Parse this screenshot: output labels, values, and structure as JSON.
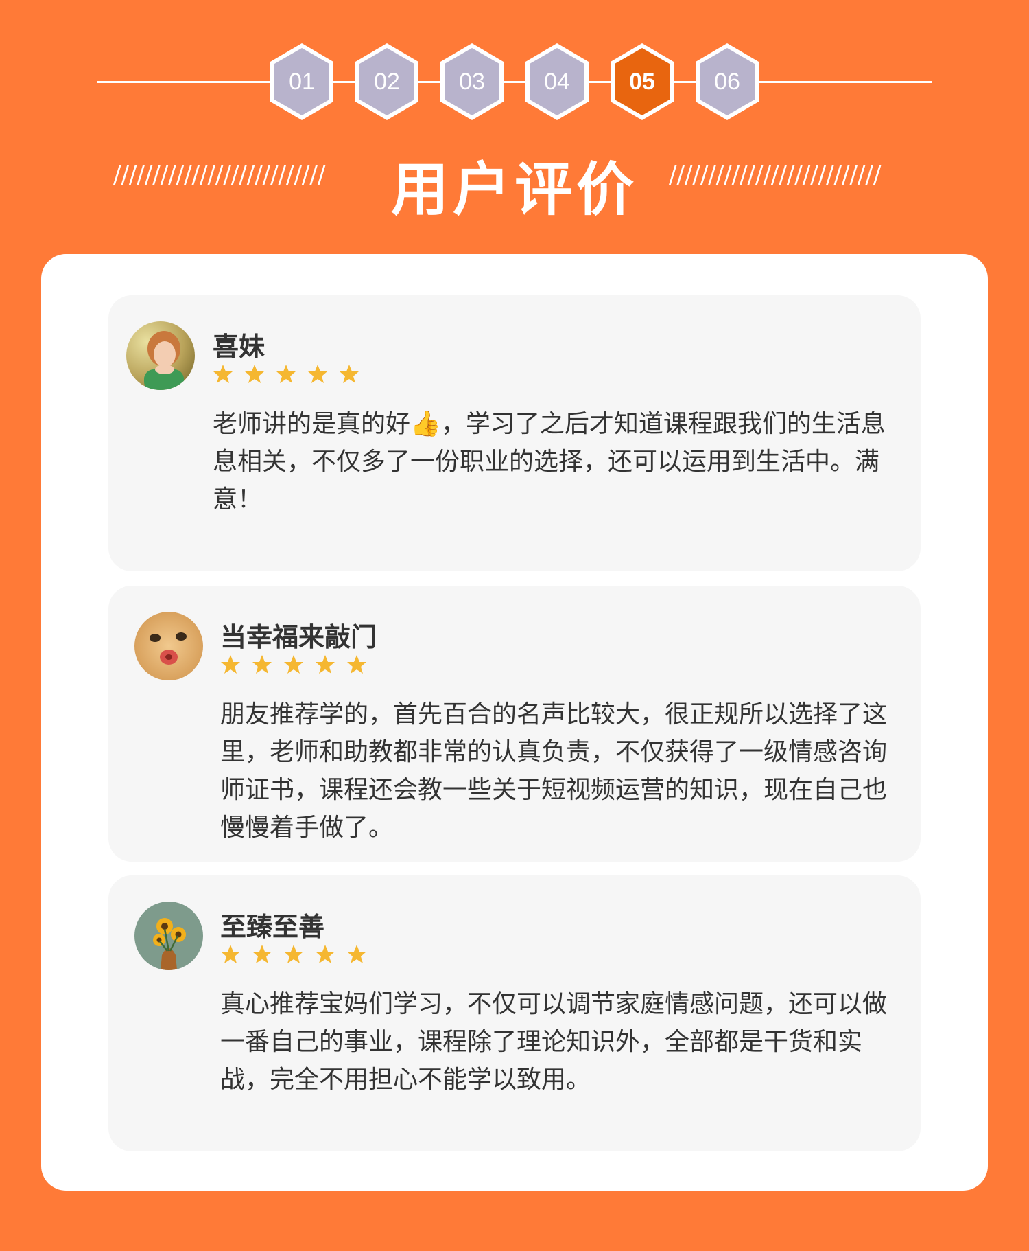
{
  "steps": [
    {
      "label": "01",
      "active": false
    },
    {
      "label": "02",
      "active": false
    },
    {
      "label": "03",
      "active": false
    },
    {
      "label": "04",
      "active": false
    },
    {
      "label": "05",
      "active": true
    },
    {
      "label": "06",
      "active": false
    }
  ],
  "colors": {
    "background": "#ff7a37",
    "step_inactive": "#b8b3cc",
    "step_active": "#e8650f",
    "card": "#f6f6f6",
    "star": "#f5b731",
    "text": "#333333"
  },
  "title": "用户评价",
  "decor": {
    "left_slashes": "///////////////////////////",
    "right_slashes": "///////////////////////////"
  },
  "reviews": [
    {
      "name": "喜妹",
      "rating": 5,
      "avatar_icon": "girl-avatar-icon",
      "text": "老师讲的是真的好👍，学习了之后才知道课程跟我们的生活息息相关，不仅多了一份职业的选择，还可以运用到生活中。满意！"
    },
    {
      "name": "当幸福来敲门",
      "rating": 5,
      "avatar_icon": "baby-avatar-icon",
      "text": "朋友推荐学的，首先百合的名声比较大，很正规所以选择了这里，老师和助教都非常的认真负责，不仅获得了一级情感咨询师证书，课程还会教一些关于短视频运营的知识，现在自己也慢慢着手做了。"
    },
    {
      "name": "至臻至善",
      "rating": 5,
      "avatar_icon": "sunflower-avatar-icon",
      "text": "真心推荐宝妈们学习，不仅可以调节家庭情感问题，还可以做一番自己的事业，课程除了理论知识外，全部都是干货和实战，完全不用担心不能学以致用。"
    }
  ]
}
